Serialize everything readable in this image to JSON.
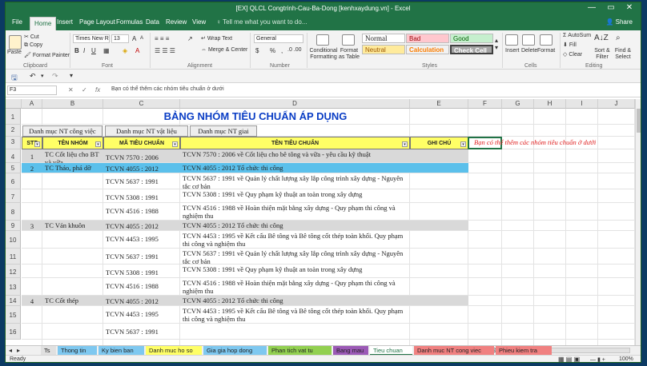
{
  "window": {
    "title": "[EX] QLCL Congtrinh-Cau-Ba-Dong [kenhxaydung.vn] - Excel",
    "minimize": "—",
    "maximize": "▭",
    "close": "✕"
  },
  "tabs": [
    "File",
    "Home",
    "Insert",
    "Page Layout",
    "Formulas",
    "Data",
    "Review",
    "View"
  ],
  "tell_me": "Tell me what you want to do...",
  "share": "Share",
  "ribbon": {
    "clipboard": {
      "paste": "Paste",
      "cut": "Cut",
      "copy": "Copy",
      "format_painter": "Format Painter",
      "label": "Clipboard"
    },
    "font": {
      "name": "Times New Ro",
      "size": "13",
      "bold": "B",
      "italic": "I",
      "underline": "U",
      "grow": "A",
      "shrink": "A",
      "label": "Font"
    },
    "alignment": {
      "wrap": "Wrap Text",
      "merge": "Merge & Center",
      "label": "Alignment"
    },
    "number": {
      "format": "General",
      "dollar": "$",
      "percent": "%",
      "comma": ",",
      "label": "Number"
    },
    "styles": {
      "conditional": "Conditional Formatting",
      "format_table": "Format as Table",
      "normal": "Normal",
      "bad": "Bad",
      "good": "Good",
      "neutral": "Neutral",
      "calculation": "Calculation",
      "check_cell": "Check Cell",
      "label": "Styles"
    },
    "cells": {
      "insert": "Insert",
      "delete": "Delete",
      "format": "Format",
      "label": "Cells"
    },
    "editing": {
      "autosum": "AutoSum",
      "fill": "Fill",
      "clear": "Clear",
      "sort": "Sort & Filter",
      "find": "Find & Select",
      "label": "Editing"
    }
  },
  "formula_bar": {
    "name_box": "F3",
    "cancel": "✕",
    "enter": "✓",
    "fx": "fx",
    "content": "Bạn có thể thêm các nhóm tiêu chuẩn ở dưới"
  },
  "columns": [
    "A",
    "B",
    "C",
    "D",
    "E",
    "F",
    "G",
    "H",
    "I",
    "J"
  ],
  "row_numbers": [
    "1",
    "2",
    "3",
    "4",
    "5",
    "6",
    "7",
    "8",
    "9",
    "10",
    "11",
    "12",
    "13",
    "14",
    "15",
    "16"
  ],
  "sheet": {
    "title": "BẢNG NHÓM TIÊU CHUẨN ÁP DỤNG",
    "buttons": [
      "Danh mục NT công việc",
      "Danh mục NT vật liệu",
      "Danh mục NT giai"
    ],
    "headers": {
      "stt": "STT",
      "nhom": "TÊN NHÓM",
      "ma": "MÃ TIÊU CHUẨN",
      "ten": "TÊN TIÊU CHUẨN",
      "ghichu": "GHI CHÚ"
    },
    "note": "Bạn có thể thêm các nhóm tiêu chuẩn ở dưới",
    "rows": [
      {
        "stt": "1",
        "nhom": "TC Cốt liệu cho BT và vữa",
        "ma": "TCVN 7570 : 2006",
        "ten": "TCVN 7570 : 2006 về Cốt liệu cho bê tông và vữa - yêu cầu kỹ thuật"
      },
      {
        "stt": "2",
        "nhom": "TC Tháo, phá dỡ",
        "ma": "TCVN 4055 : 2012",
        "ten": "TCVN 4055 : 2012 Tổ chức thi công"
      },
      {
        "stt": "",
        "nhom": "",
        "ma": "TCVN 5637 : 1991",
        "ten": "TCVN 5637 : 1991 về Quản lý chất lượng xây lắp công trình xây dựng - Nguyên tắc cơ bản"
      },
      {
        "stt": "",
        "nhom": "",
        "ma": "TCVN 5308 : 1991",
        "ten": "TCVN 5308 : 1991 về Quy phạm kỹ thuật an toàn trong xây dựng"
      },
      {
        "stt": "",
        "nhom": "",
        "ma": "TCVN 4516 : 1988",
        "ten": "TCVN 4516 : 1988 về Hoàn thiện mặt bằng xây dựng - Quy phạm thi công và nghiệm thu"
      },
      {
        "stt": "3",
        "nhom": "TC Ván khuôn",
        "ma": "TCVN 4055 : 2012",
        "ten": "TCVN 4055 : 2012 Tổ chức thi công"
      },
      {
        "stt": "",
        "nhom": "",
        "ma": "TCVN 4453 : 1995",
        "ten": "TCVN 4453 : 1995 về Kết cấu Bê tông và Bê tông cốt thép toàn khối. Quy phạm thi công và nghiệm thu"
      },
      {
        "stt": "",
        "nhom": "",
        "ma": "TCVN 5637 : 1991",
        "ten": "TCVN 5637 : 1991 về Quản lý chất lượng xây lắp công trình xây dựng - Nguyên tắc cơ bản"
      },
      {
        "stt": "",
        "nhom": "",
        "ma": "TCVN 5308 : 1991",
        "ten": "TCVN 5308 : 1991 về Quy phạm kỹ thuật an toàn trong xây dựng"
      },
      {
        "stt": "",
        "nhom": "",
        "ma": "TCVN 4516 : 1988",
        "ten": "TCVN 4516 : 1988 về Hoàn thiện mặt bằng xây dựng - Quy phạm thi công và nghiệm thu"
      },
      {
        "stt": "4",
        "nhom": "TC Cốt thép",
        "ma": "TCVN 4055 : 2012",
        "ten": "TCVN 4055 : 2012 Tổ chức thi công"
      },
      {
        "stt": "",
        "nhom": "",
        "ma": "TCVN 4453 : 1995",
        "ten": "TCVN 4453 : 1995 về Kết cấu Bê tông và Bê tông cốt thép toàn khối. Quy phạm thi công và nghiệm thu"
      },
      {
        "stt": "",
        "nhom": "",
        "ma": "TCVN 5637 : 1991",
        "ten": ""
      }
    ]
  },
  "sheet_tabs": [
    {
      "label": "Ts",
      "color": "#e0e0e0"
    },
    {
      "label": "Thong tin",
      "color": "#7ec8f0"
    },
    {
      "label": "Ky bien ban",
      "color": "#7ec8f0"
    },
    {
      "label": "Danh muc ho so",
      "color": "#ffff66"
    },
    {
      "label": "Gia gia hop dong",
      "color": "#7ec8f0"
    },
    {
      "label": "Phan tich vat tu",
      "color": "#92d050"
    },
    {
      "label": "Bang mau",
      "color": "#9b59b6"
    },
    {
      "label": "Tieu chuan",
      "color": "#ffffff"
    },
    {
      "label": "Danh muc NT cong viec",
      "color": "#f08080"
    },
    {
      "label": "Phieu kiem tra",
      "color": "#f08080"
    }
  ],
  "status": {
    "ready": "Ready",
    "zoom": "100%"
  }
}
